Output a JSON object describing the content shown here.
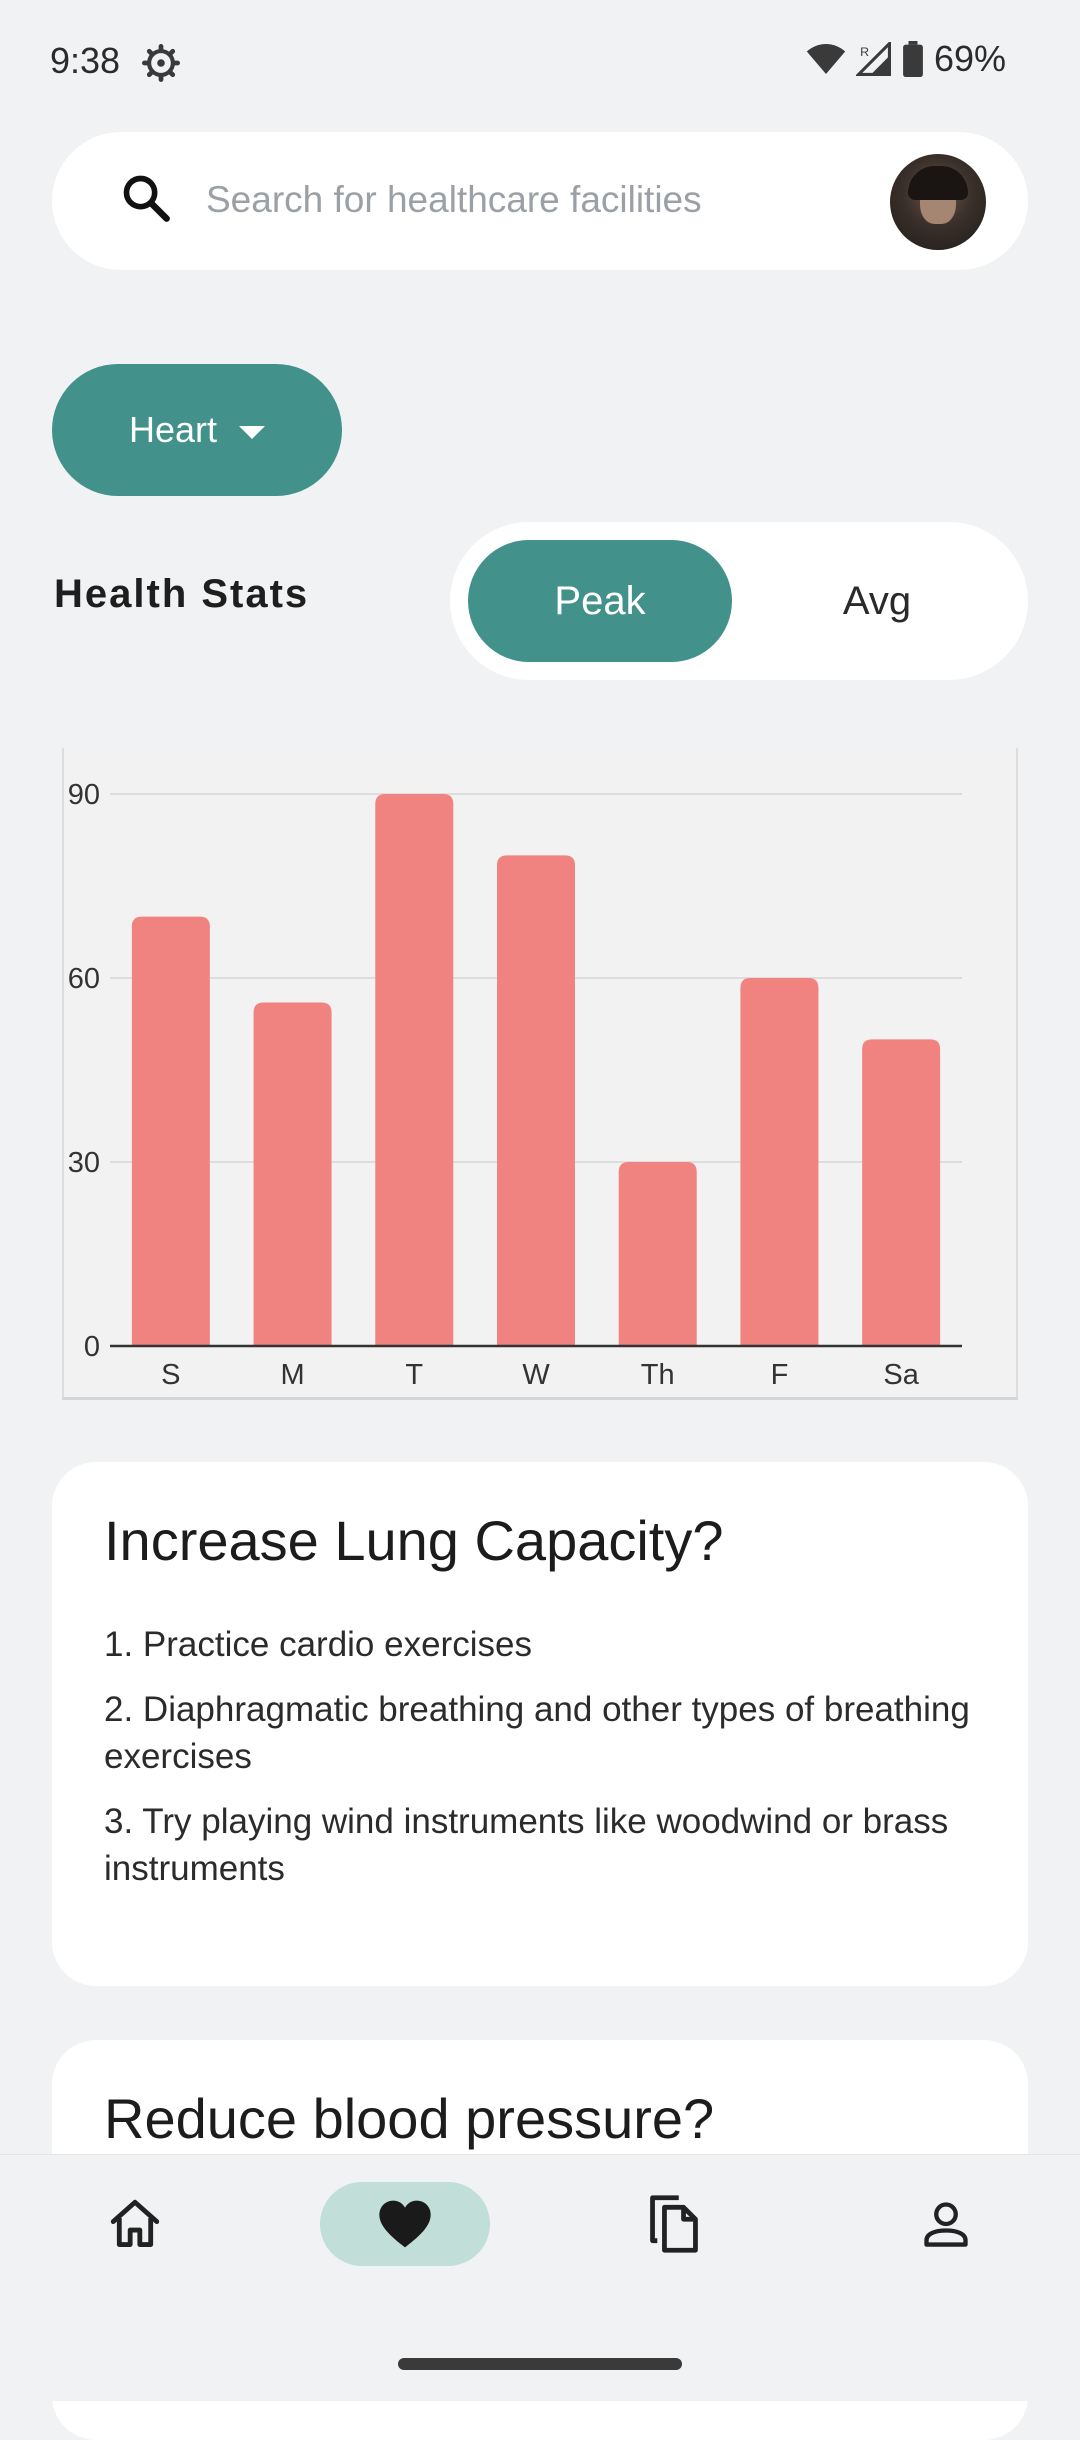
{
  "status_bar": {
    "time": "9:38",
    "battery": "69%",
    "icons": [
      "gear-icon",
      "wifi-icon",
      "signal-icon",
      "battery-icon"
    ]
  },
  "search": {
    "placeholder": "Search for healthcare facilities",
    "value": ""
  },
  "category": {
    "selected": "Heart"
  },
  "health_stats": {
    "title": "Health Stats",
    "toggle": {
      "peak_label": "Peak",
      "avg_label": "Avg",
      "active": "Peak"
    }
  },
  "chart_data": {
    "type": "bar",
    "categories": [
      "S",
      "M",
      "T",
      "W",
      "Th",
      "F",
      "Sa"
    ],
    "values": [
      70,
      56,
      90,
      80,
      30,
      60,
      50
    ],
    "ylim": [
      0,
      90
    ],
    "yticks": [
      0,
      30,
      60,
      90
    ],
    "grid": true,
    "bar_color": "#f08380"
  },
  "cards": [
    {
      "title": "Increase Lung Capacity?",
      "items": [
        "1. Practice cardio exercises",
        "2. Diaphragmatic breathing and other types of breathing exercises",
        "3. Try playing wind instruments like woodwind or brass instruments"
      ]
    },
    {
      "title": "Reduce blood pressure?"
    }
  ],
  "bottom_nav": {
    "items": [
      "home-icon",
      "heart-icon",
      "documents-icon",
      "profile-icon"
    ],
    "active": "heart-icon"
  },
  "colors": {
    "accent": "#42918a",
    "accent_light": "#c1ded9",
    "bar": "#f08380",
    "background": "#f1f2f4"
  }
}
